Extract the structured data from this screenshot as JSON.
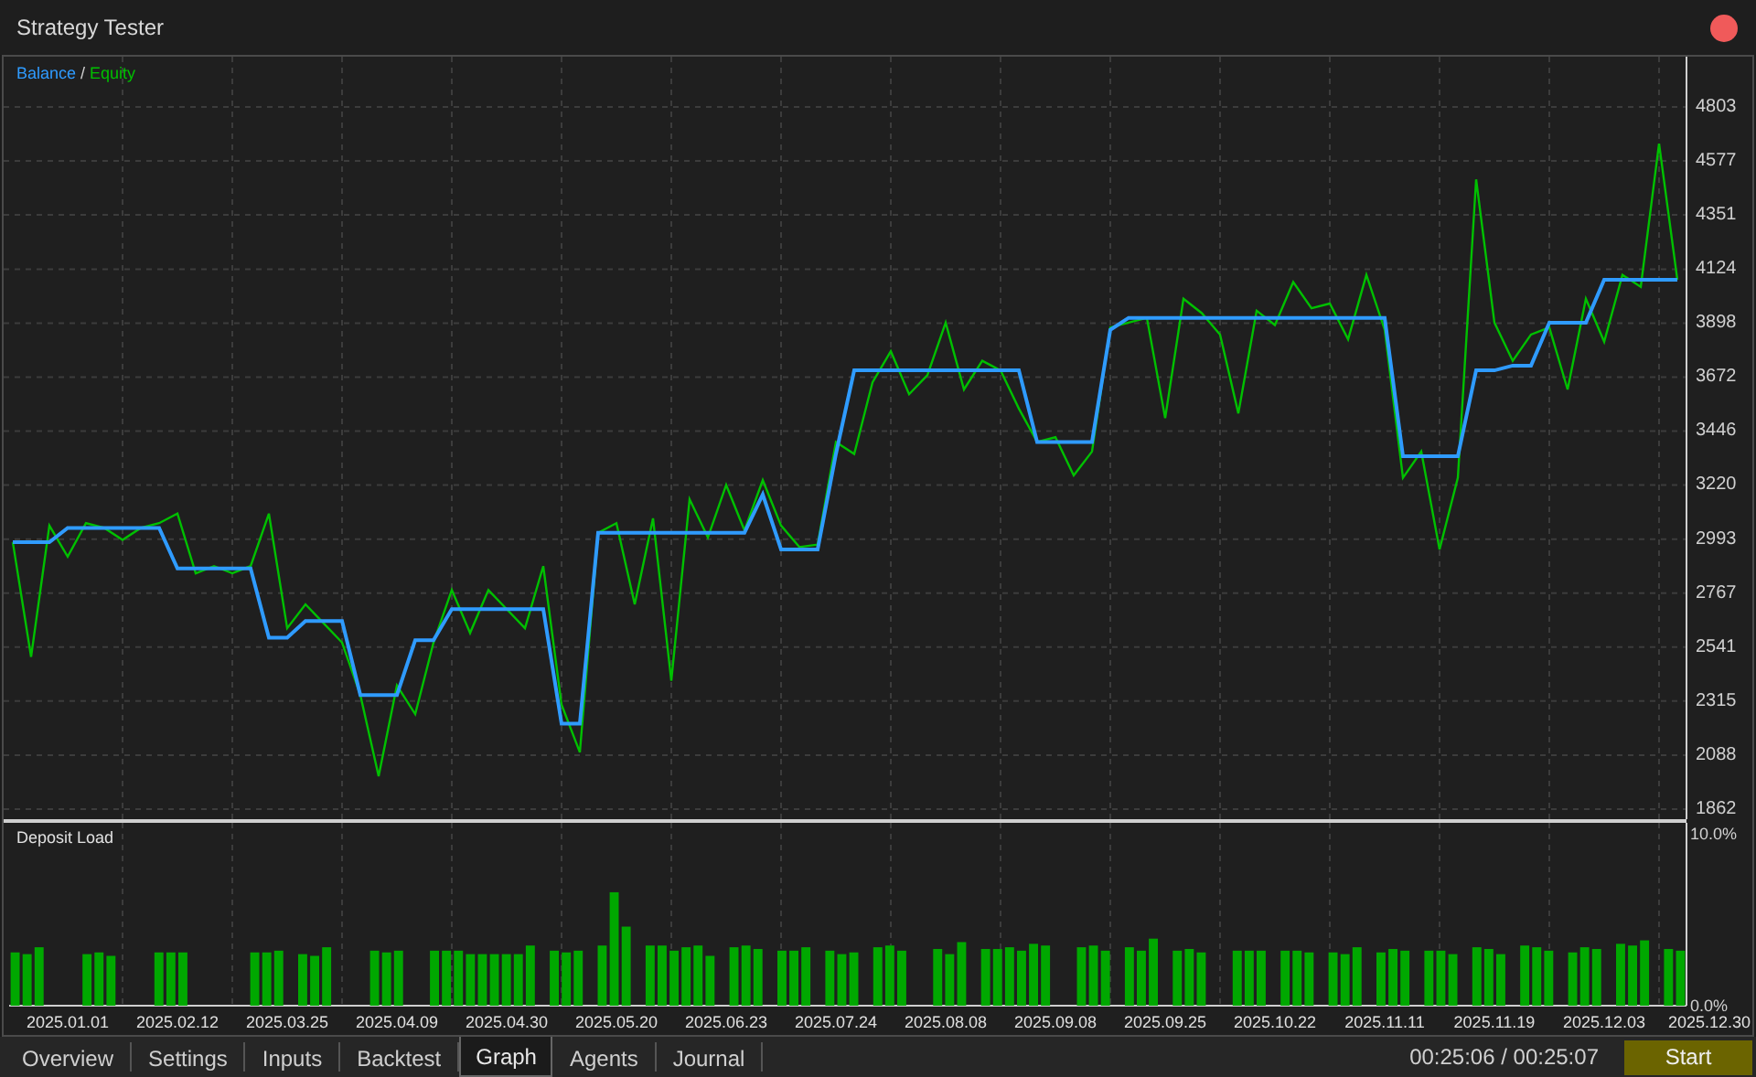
{
  "window": {
    "title": "Strategy Tester"
  },
  "balance_chart": {
    "legend_separator": "/",
    "chart_data": {
      "type": "line",
      "grid": true,
      "ylim": [
        1820,
        5014
      ],
      "yticks": [
        1862,
        2088,
        2315,
        2541,
        2767,
        2993,
        3220,
        3446,
        3672,
        3898,
        4124,
        4351,
        4577,
        4803
      ],
      "series": [
        {
          "name": "Balance",
          "color": "#2f9bff",
          "values": [
            2980,
            2980,
            2980,
            3040,
            3040,
            3040,
            3040,
            3040,
            3040,
            2870,
            2870,
            2870,
            2870,
            2870,
            2580,
            2580,
            2650,
            2650,
            2650,
            2340,
            2340,
            2340,
            2570,
            2570,
            2700,
            2700,
            2700,
            2700,
            2700,
            2700,
            2220,
            2220,
            3020,
            3020,
            3020,
            3020,
            3020,
            3020,
            3020,
            3020,
            3020,
            3180,
            2950,
            2950,
            2950,
            3350,
            3700,
            3700,
            3700,
            3700,
            3700,
            3700,
            3700,
            3700,
            3700,
            3700,
            3400,
            3400,
            3400,
            3400,
            3870,
            3920,
            3920,
            3920,
            3920,
            3920,
            3920,
            3920,
            3920,
            3920,
            3920,
            3920,
            3920,
            3920,
            3920,
            3920,
            3340,
            3340,
            3340,
            3340,
            3700,
            3700,
            3720,
            3720,
            3900,
            3900,
            3900,
            4080,
            4080,
            4080,
            4080,
            4080
          ]
        },
        {
          "name": "Equity",
          "color": "#00c000",
          "values": [
            2980,
            2500,
            3050,
            2920,
            3060,
            3040,
            2990,
            3040,
            3060,
            3100,
            2850,
            2880,
            2850,
            2880,
            3100,
            2620,
            2720,
            2640,
            2560,
            2340,
            2000,
            2380,
            2260,
            2560,
            2780,
            2600,
            2780,
            2700,
            2620,
            2880,
            2300,
            2100,
            3020,
            3060,
            2720,
            3080,
            2400,
            3160,
            3000,
            3220,
            3030,
            3240,
            3050,
            2960,
            2970,
            3400,
            3350,
            3650,
            3780,
            3600,
            3680,
            3900,
            3620,
            3740,
            3700,
            3540,
            3400,
            3420,
            3260,
            3360,
            3880,
            3900,
            3920,
            3500,
            4000,
            3940,
            3850,
            3520,
            3950,
            3890,
            4070,
            3960,
            3980,
            3830,
            4100,
            3870,
            3250,
            3360,
            2950,
            3250,
            4500,
            3900,
            3740,
            3850,
            3880,
            3620,
            4000,
            3820,
            4100,
            4050,
            4650,
            4080
          ]
        }
      ]
    }
  },
  "deposit_chart": {
    "dates": [
      "2025.01.01",
      "2025.02.12",
      "2025.03.25",
      "2025.04.09",
      "2025.04.30",
      "2025.05.20",
      "2025.06.23",
      "2025.07.24",
      "2025.08.08",
      "2025.09.08",
      "2025.09.25",
      "2025.10.22",
      "2025.11.11",
      "2025.11.19",
      "2025.12.03",
      "2025.12.30"
    ],
    "chart_data": {
      "type": "bar",
      "ylim": [
        0,
        10
      ],
      "yticks": [
        {
          "value": 10,
          "label": "10.0%"
        },
        {
          "value": 0,
          "label": "0.0%"
        }
      ],
      "series": [
        {
          "name": "Deposit Load",
          "color": "#00a800",
          "values": [
            3.1,
            3.0,
            3.4,
            null,
            null,
            null,
            3.0,
            3.1,
            2.9,
            null,
            null,
            null,
            3.1,
            3.1,
            3.1,
            null,
            null,
            null,
            null,
            null,
            3.1,
            3.1,
            3.2,
            null,
            3.0,
            2.9,
            3.4,
            null,
            null,
            null,
            3.2,
            3.1,
            3.2,
            null,
            null,
            3.2,
            3.2,
            3.2,
            3.0,
            3.0,
            3.0,
            3.0,
            3.0,
            3.5,
            null,
            3.2,
            3.1,
            3.2,
            null,
            3.5,
            6.6,
            4.6,
            null,
            3.5,
            3.5,
            3.2,
            3.4,
            3.5,
            2.9,
            null,
            3.4,
            3.5,
            3.3,
            null,
            3.2,
            3.2,
            3.4,
            null,
            3.2,
            3.0,
            3.1,
            null,
            3.4,
            3.5,
            3.2,
            null,
            null,
            3.3,
            3.0,
            3.7,
            null,
            3.3,
            3.3,
            3.4,
            3.2,
            3.6,
            3.5,
            null,
            null,
            3.4,
            3.5,
            3.2,
            null,
            3.4,
            3.2,
            3.9,
            null,
            3.2,
            3.3,
            3.1,
            null,
            null,
            3.2,
            3.2,
            3.2,
            null,
            3.2,
            3.2,
            3.1,
            null,
            3.1,
            3.0,
            3.4,
            null,
            3.1,
            3.3,
            3.2,
            null,
            3.2,
            3.2,
            3.0,
            null,
            3.4,
            3.3,
            3.0,
            null,
            3.5,
            3.4,
            3.2,
            null,
            3.1,
            3.4,
            3.3,
            null,
            3.6,
            3.5,
            3.8,
            null,
            3.3,
            3.2
          ]
        }
      ]
    }
  },
  "tabs": [
    {
      "label": "Overview",
      "selected": false
    },
    {
      "label": "Settings",
      "selected": false
    },
    {
      "label": "Inputs",
      "selected": false
    },
    {
      "label": "Backtest",
      "selected": false
    },
    {
      "label": "Graph",
      "selected": true
    },
    {
      "label": "Agents",
      "selected": false
    },
    {
      "label": "Journal",
      "selected": false
    }
  ],
  "timer": "00:25:06 / 00:25:07",
  "start_button": "Start"
}
